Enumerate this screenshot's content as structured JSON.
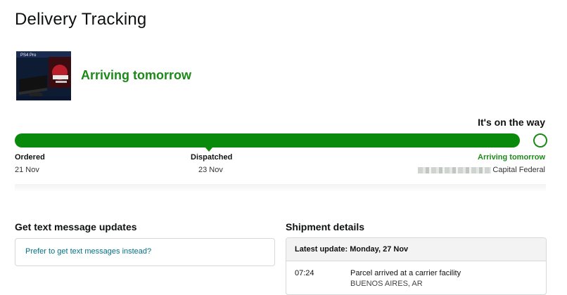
{
  "page": {
    "title": "Delivery Tracking"
  },
  "product": {
    "image": "ps4-pro-gran-turismo-bundle-box"
  },
  "headline": "Arriving tomorrow",
  "status_label": "It's on the way",
  "progress": {
    "completed_fraction": 0.96
  },
  "steps": [
    {
      "label": "Ordered",
      "date": "21 Nov"
    },
    {
      "label": "Dispatched",
      "date": "23 Nov"
    },
    {
      "label": "Arriving tomorrow",
      "location": "Capital Federal"
    }
  ],
  "sms": {
    "heading": "Get text message updates",
    "link": "Prefer to get text messages instead?"
  },
  "shipment": {
    "heading": "Shipment details",
    "latest_update": "Latest update: Monday, 27 Nov",
    "events": [
      {
        "time": "07:24",
        "event": "Parcel arrived at a carrier facility",
        "location": "BUENOS AIRES, AR"
      }
    ]
  },
  "colors": {
    "accent_green": "#1c8a18",
    "link": "#007185"
  }
}
